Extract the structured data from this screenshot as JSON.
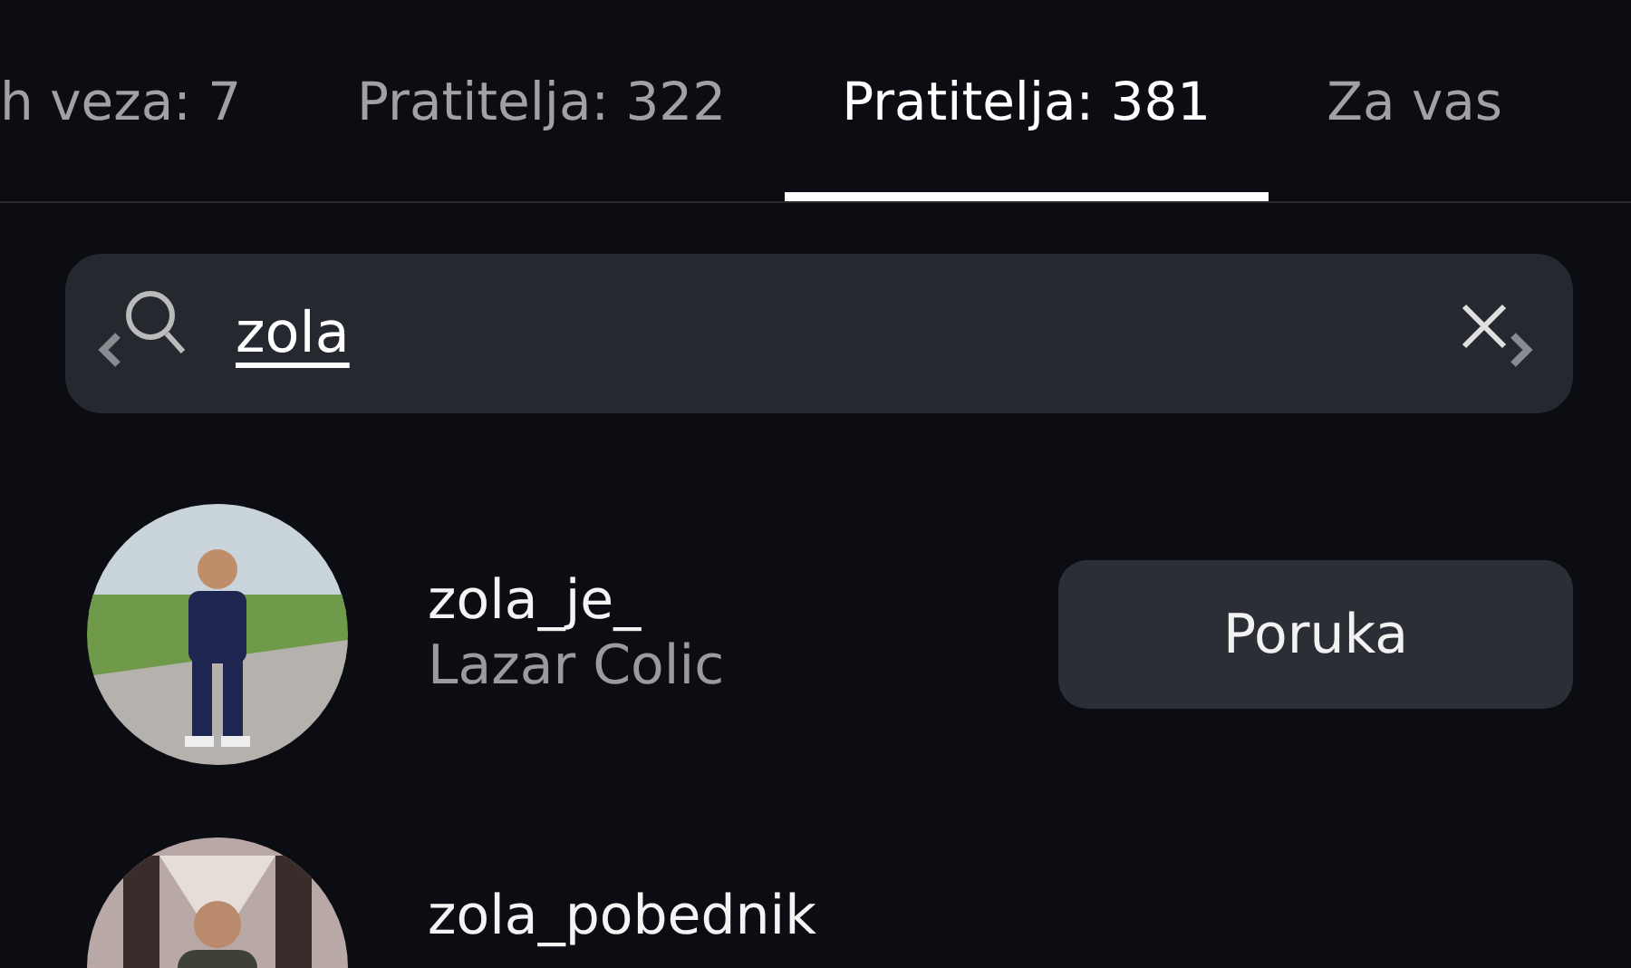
{
  "tabs": [
    {
      "label": "h veza: 7",
      "selected": false
    },
    {
      "label": "Pratitelja: 322",
      "selected": false
    },
    {
      "label": "Pratitelja: 381",
      "selected": true
    },
    {
      "label": "Za vas",
      "selected": false
    }
  ],
  "search": {
    "value": "zola"
  },
  "results": [
    {
      "username": "zola_je_",
      "full_name": "Lazar Colic",
      "button": "Poruka"
    },
    {
      "username": "zola_pobednik"
    }
  ]
}
